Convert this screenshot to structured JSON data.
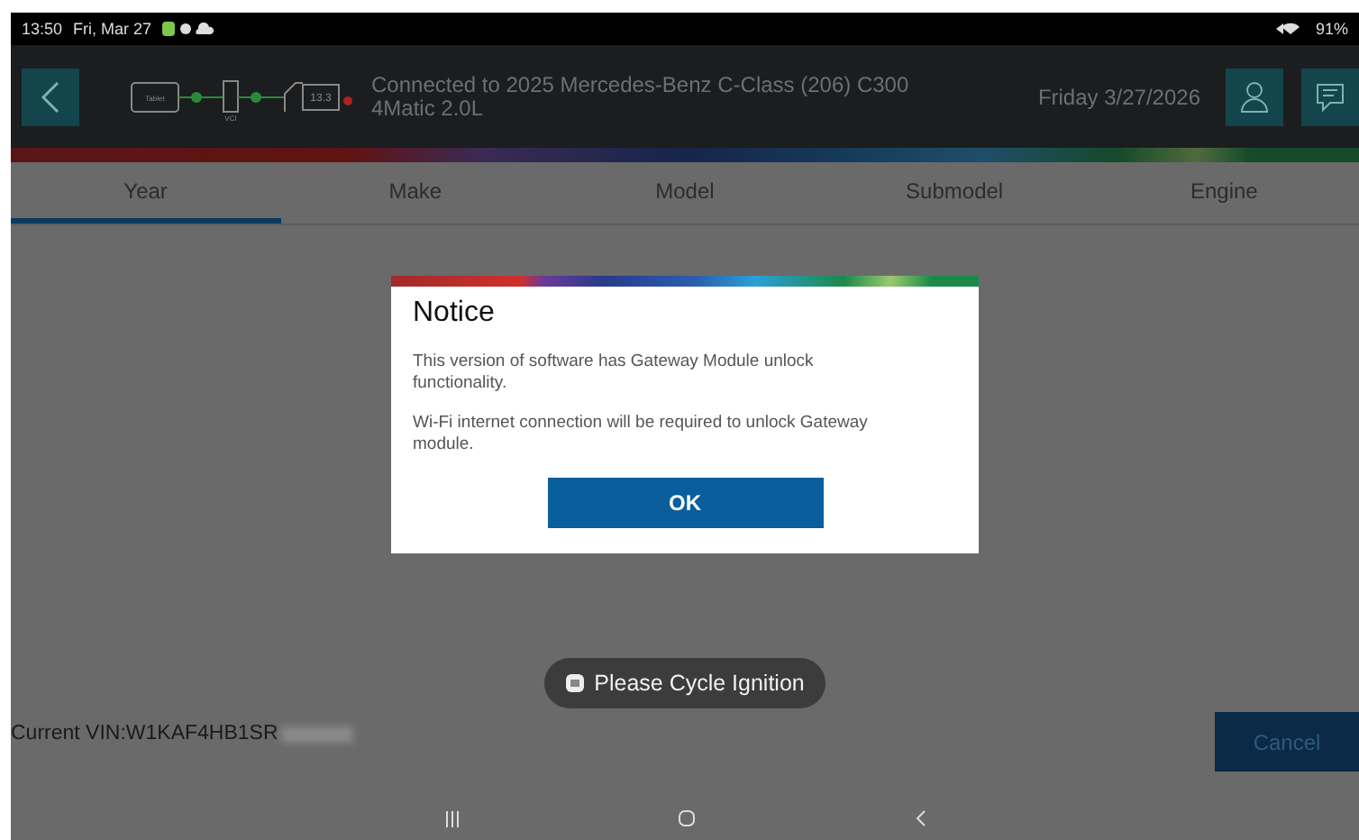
{
  "status_bar": {
    "time": "13:50",
    "date": "Fri, Mar 27",
    "battery": "91%"
  },
  "header": {
    "connection_diagram": {
      "tablet_label": "Tablet",
      "vci_label": "VCI",
      "voltage": "13.3"
    },
    "vehicle": "Connected to 2025 Mercedes-Benz C-Class (206) C300 4Matic 2.0L",
    "date": "Friday 3/27/2026"
  },
  "tabs": [
    {
      "label": "Year",
      "selected": true
    },
    {
      "label": "Make",
      "selected": false
    },
    {
      "label": "Model",
      "selected": false
    },
    {
      "label": "Submodel",
      "selected": false
    },
    {
      "label": "Engine",
      "selected": false
    }
  ],
  "dialog": {
    "title": "Notice",
    "paragraphs": [
      "This version of software has Gateway Module unlock functionality.",
      "Wi-Fi internet connection will be required to unlock Gateway module."
    ],
    "button": "OK"
  },
  "toast": "Please Cycle Ignition",
  "vin": "Current VIN:W1KAF4HB1SR",
  "cancel_button": "Cancel"
}
